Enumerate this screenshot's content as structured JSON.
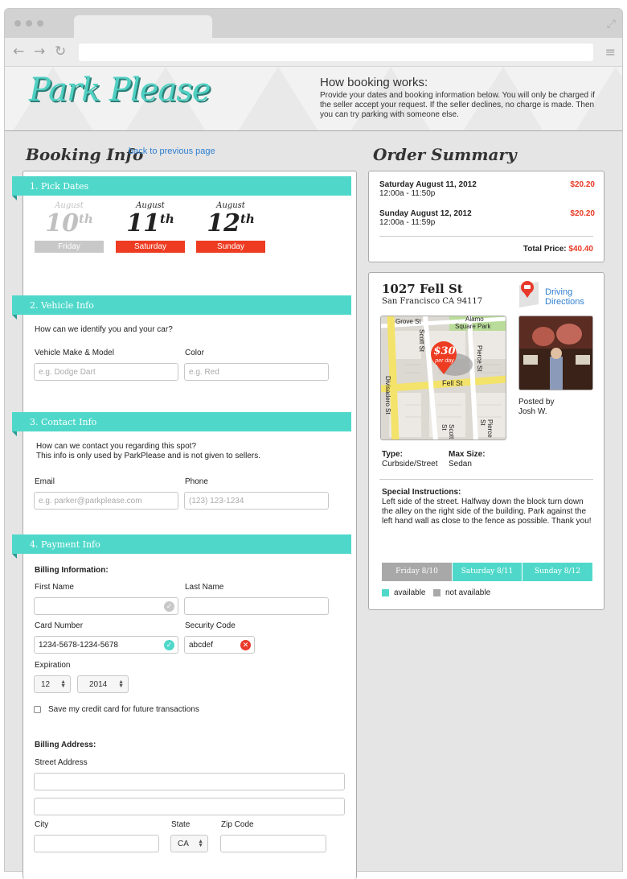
{
  "header": {
    "logo": "Park Please",
    "how_title": "How booking works:",
    "how_text": "Provide your dates and booking information below. You will only be charged if the seller accept your request. If the seller declines, no charge is made. Then you can try parking with someone else."
  },
  "booking": {
    "title": "Booking Info",
    "back_link": "back to previous page",
    "sections": [
      "1. Pick Dates",
      "2. Vehicle Info",
      "3. Contact Info",
      "4. Payment Info"
    ],
    "dates": [
      {
        "month": "August",
        "num": "10",
        "suffix": "th",
        "day": "Friday"
      },
      {
        "month": "August",
        "num": "11",
        "suffix": "th",
        "day": "Saturday"
      },
      {
        "month": "August",
        "num": "12",
        "suffix": "th",
        "day": "Sunday"
      }
    ],
    "vehicle": {
      "question": "How can we identify you and your car?",
      "make_label": "Vehicle Make & Model",
      "make_placeholder": "e.g. Dodge Dart",
      "color_label": "Color",
      "color_placeholder": "e.g. Red"
    },
    "contact": {
      "question": "How can we contact you regarding this spot?",
      "note": "This info is only used by ParkPlease and is not given to sellers.",
      "email_label": "Email",
      "email_placeholder": "e.g. parker@parkplease.com",
      "phone_label": "Phone",
      "phone_placeholder": "(123) 123-1234"
    },
    "payment": {
      "billing_info": "Billing Information:",
      "first_name": "First Name",
      "last_name": "Last Name",
      "card_label": "Card Number",
      "card_value": "1234-5678-1234-5678",
      "security_label": "Security Code",
      "security_value": "abcdef",
      "expiration_label": "Expiration",
      "exp_month": "12",
      "exp_year": "2014",
      "save_card": "Save my credit card for future transactions",
      "billing_address": "Billing Address:",
      "street_label": "Street Address",
      "city_label": "City",
      "state_label": "State",
      "state_value": "CA",
      "zip_label": "Zip Code"
    }
  },
  "order": {
    "title": "Order Summary",
    "items": [
      {
        "date": "Saturday August 11, 2012",
        "time": "12:00a - 11:50p",
        "price": "$20.20"
      },
      {
        "date": "Sunday August 12, 2012",
        "time": "12:00a - 11:59p",
        "price": "$20.20"
      }
    ],
    "total_label": "Total Price:",
    "total": "$40.40"
  },
  "spot": {
    "address": "1027 Fell St",
    "city": "San Francisco CA 94117",
    "directions_1": "Driving",
    "directions_2": "Directions",
    "map_price": "$30",
    "map_per": "per day",
    "streets": [
      "Grove St",
      "Alamo",
      "Square Park",
      "Scott St",
      "Pierce St",
      "Fell St",
      "Divisadero St",
      "Scott St",
      "Pierce St"
    ],
    "posted_by": "Posted by",
    "poster": "Josh W.",
    "type_label": "Type:",
    "type_value": "Curbside/Street",
    "size_label": "Max Size:",
    "size_value": "Sedan",
    "instructions_label": "Special Instructions:",
    "instructions": "Left side of the street. Halfway down the block turn down the alley on the right side of the building. Park against the left hand wall as close to the fence as possible. Thank you!",
    "availability": [
      {
        "label": "Friday 8/10",
        "available": false
      },
      {
        "label": "Saturday 8/11",
        "available": true
      },
      {
        "label": "Sunday 8/12",
        "available": true
      }
    ],
    "legend_available": "available",
    "legend_not": "not available"
  },
  "colors": {
    "teal": "#4fd8ca",
    "red": "#ed3c22",
    "grey": "#a8a8a8"
  }
}
